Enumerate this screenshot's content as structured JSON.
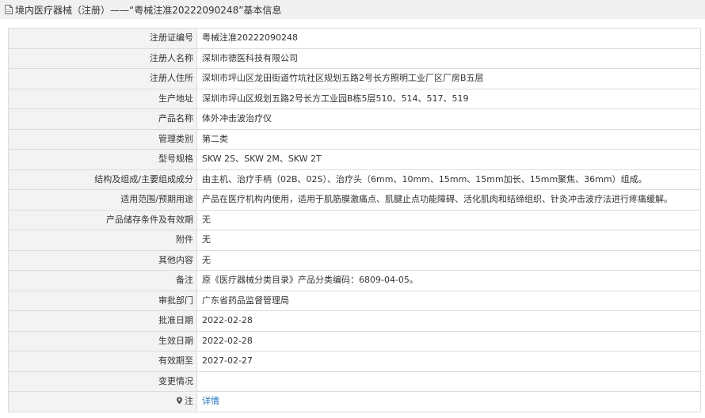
{
  "header": {
    "title": "境内医疗器械（注册）——“粤械注准20222090248”基本信息"
  },
  "rows": [
    {
      "label": "注册证编号",
      "value": "粤械注准20222090248"
    },
    {
      "label": "注册人名称",
      "value": "深圳市德医科技有限公司"
    },
    {
      "label": "注册人住所",
      "value": "深圳市坪山区龙田街道竹坑社区规划五路2号长方照明工业厂区厂房B五层"
    },
    {
      "label": "生产地址",
      "value": "深圳市坪山区规划五路2号长方工业园B栋5层510、514、517、519"
    },
    {
      "label": "产品名称",
      "value": "体外冲击波治疗仪"
    },
    {
      "label": "管理类别",
      "value": "第二类"
    },
    {
      "label": "型号规格",
      "value": "SKW 2S、SKW 2M、SKW 2T"
    },
    {
      "label": "结构及组成/主要组成成分",
      "value": "由主机、治疗手柄（02B、02S）、治疗头（6mm、10mm、15mm、15mm加长、15mm聚焦、36mm）组成。"
    },
    {
      "label": "适用范围/预期用途",
      "value": "产品在医疗机构内使用，适用于肌筋膜激痛点、肌腱止点功能障碍、活化肌肉和结缔组织、针灸冲击波疗法进行疼痛缓解。"
    },
    {
      "label": "产品储存条件及有效期",
      "value": "无"
    },
    {
      "label": "附件",
      "value": "无"
    },
    {
      "label": "其他内容",
      "value": "无"
    },
    {
      "label": "备注",
      "value": "原《医疗器械分类目录》产品分类编码：6809-04-05。"
    },
    {
      "label": "审批部门",
      "value": "广东省药品监督管理局"
    },
    {
      "label": "批准日期",
      "value": "2022-02-28"
    },
    {
      "label": "生效日期",
      "value": "2022-02-28"
    },
    {
      "label": "有效期至",
      "value": "2027-02-27"
    },
    {
      "label": "变更情况",
      "value": ""
    }
  ],
  "note": {
    "label": "注",
    "link_text": "详情"
  },
  "colors": {
    "header_bg": "#f0f0f0",
    "label_bg": "#f3f3f3",
    "border": "#dcdcdc",
    "link": "#1e6fc0"
  },
  "icons": {
    "header": "document-icon",
    "note": "location-pin-icon"
  }
}
